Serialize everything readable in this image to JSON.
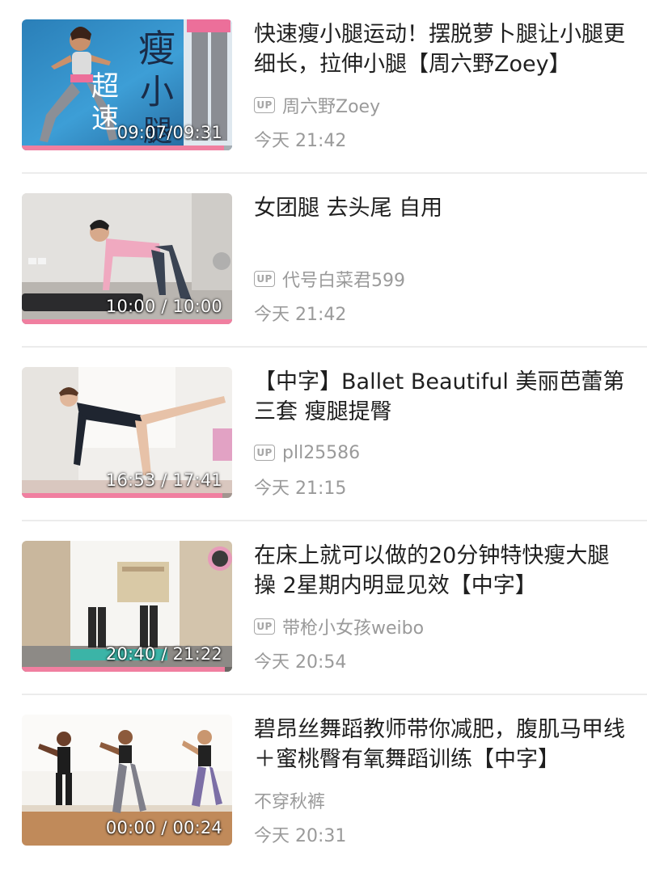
{
  "videos": [
    {
      "title": "快速瘦小腿运动！摆脱萝卜腿让小腿更细长，拉伸小腿【周六野Zoey】",
      "uploader": "周六野Zoey",
      "up_badge": "UP",
      "time": "今天 21:42",
      "duration": "09:07/09:31",
      "progress": 0.96,
      "thumb_overlay": [
        "瘦",
        "小",
        "超",
        "速",
        "腿"
      ]
    },
    {
      "title": "女团腿 去头尾 自用",
      "uploader": "代号白菜君599",
      "up_badge": "UP",
      "time": "今天 21:42",
      "duration": "10:00 / 10:00",
      "progress": 1.0
    },
    {
      "title": "【中字】Ballet Beautiful 美丽芭蕾第三套 瘦腿提臀",
      "uploader": "pll25586",
      "up_badge": "UP",
      "time": "今天 21:15",
      "duration": "16:53 / 17:41",
      "progress": 0.955
    },
    {
      "title": "在床上就可以做的20分钟特快瘦大腿操 2星期内明显见效【中字】",
      "uploader": "带枪小女孩weibo",
      "up_badge": "UP",
      "time": "今天 20:54",
      "duration": "20:40 / 21:22",
      "progress": 0.967
    },
    {
      "title": "碧昂丝舞蹈教师带你减肥，腹肌马甲线＋蜜桃臀有氧舞蹈训练【中字】",
      "uploader": "不穿秋裤",
      "time": "今天 20:31",
      "duration": "00:00 / 00:24",
      "progress": 0.0
    }
  ],
  "colors": {
    "progress": "#f07fa0",
    "meta_text": "#9a9a9a",
    "title_text": "#1f1f1f",
    "divider": "#ececec"
  }
}
